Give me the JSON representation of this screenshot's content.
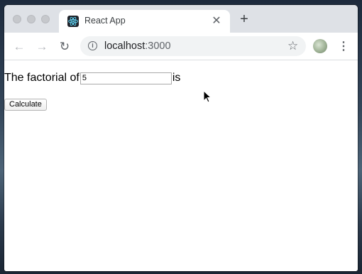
{
  "browser": {
    "tab_title": "React App",
    "close_tab_glyph": "✕",
    "new_tab_glyph": "+",
    "url_host": "localhost",
    "url_port": ":3000",
    "back_glyph": "←",
    "forward_glyph": "→",
    "reload_glyph": "↻",
    "bookmark_glyph": "☆",
    "menu_glyph": "⋮",
    "info_glyph": "i"
  },
  "page": {
    "label_before": "The factorial of",
    "input_value": "5",
    "label_after": "is",
    "button_label": "Calculate"
  },
  "colors": {
    "tabstrip": "#dee1e6",
    "omnibox": "#f1f3f4",
    "react_logo": "#61dafb"
  },
  "icons": [
    "react-logo-icon",
    "close-icon",
    "plus-icon",
    "back-arrow-icon",
    "forward-arrow-icon",
    "reload-icon",
    "info-icon",
    "star-icon",
    "profile-avatar",
    "kebab-menu-icon",
    "mouse-cursor-icon"
  ]
}
